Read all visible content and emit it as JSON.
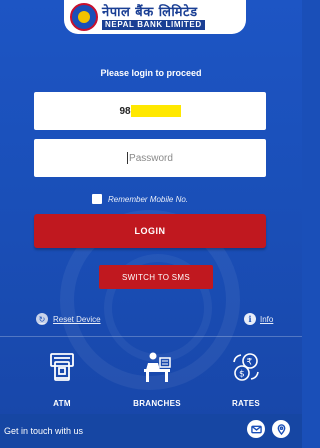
{
  "header": {
    "logo_nepali": "नेपाल बैंक लिमिटेड",
    "logo_english": "NEPAL BANK LIMITED"
  },
  "login": {
    "prompt": "Please login to proceed",
    "mobile_value": "98",
    "password_placeholder": "Password",
    "remember_label": "Remember Mobile No.",
    "login_label": "LOGIN",
    "sms_label": "SWITCH TO SMS"
  },
  "links": {
    "reset_label": "Reset Device",
    "info_label": "Info"
  },
  "quick_access": [
    {
      "label": "ATM",
      "icon": "atm-icon"
    },
    {
      "label": "BRANCHES",
      "icon": "branches-icon"
    },
    {
      "label": "RATES",
      "icon": "rates-icon"
    }
  ],
  "footer": {
    "text": "Get in touch with us",
    "icons": [
      "mail-icon",
      "location-icon"
    ]
  },
  "colors": {
    "background": "#1a4fb8",
    "button_red": "#c0181f",
    "redaction_yellow": "#ffe800"
  }
}
